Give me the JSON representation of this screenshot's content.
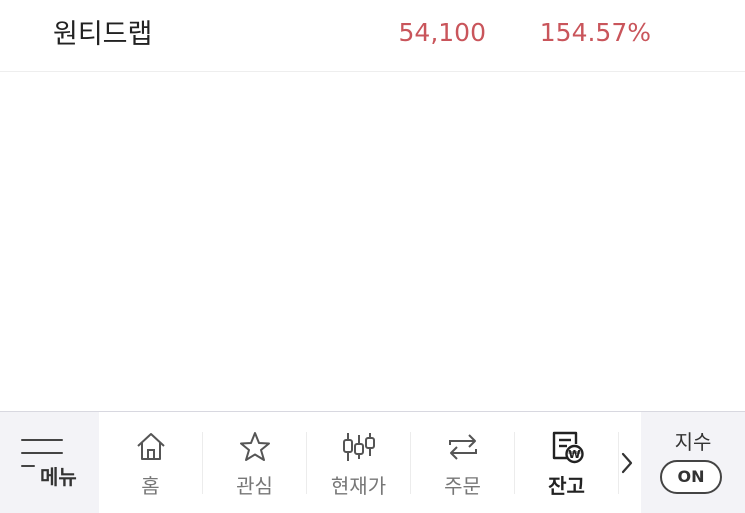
{
  "stock": {
    "name": "원티드랩",
    "price": "54,100",
    "change_rate": "154.57%",
    "color": "#c9555b"
  },
  "bottom_nav": {
    "menu_label": "메뉴",
    "items": [
      {
        "label": "홈",
        "icon": "home-icon"
      },
      {
        "label": "관심",
        "icon": "star-icon"
      },
      {
        "label": "현재가",
        "icon": "candlestick-icon"
      },
      {
        "label": "주문",
        "icon": "exchange-arrows-icon"
      },
      {
        "label": "잔고",
        "icon": "balance-document-icon",
        "active": true
      }
    ],
    "more_icon": "chevron-right-icon"
  },
  "index_panel": {
    "label": "지수",
    "toggle": "ON"
  }
}
